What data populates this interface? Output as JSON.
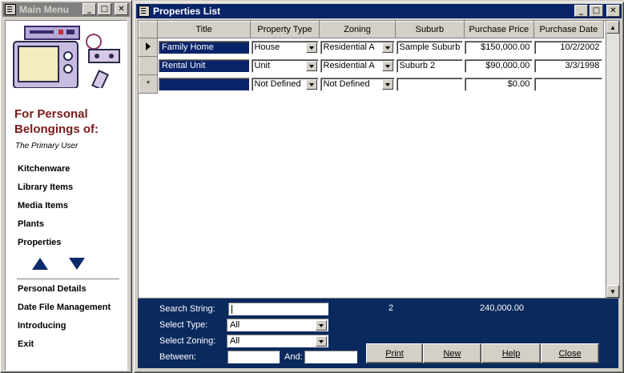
{
  "main_menu": {
    "title": "Main Menu",
    "tagline_1": "For Personal",
    "tagline_2": "Belongings of:",
    "user": "The Primary User",
    "categories": [
      "Kitchenware",
      "Library Items",
      "Media Items",
      "Plants",
      "Properties"
    ],
    "actions": [
      "Personal Details",
      "Date File Management",
      "Introducing",
      "Exit"
    ]
  },
  "props": {
    "title": "Properties List",
    "columns": [
      "Title",
      "Property Type",
      "Zoning",
      "Suburb",
      "Purchase Price",
      "Purchase Date"
    ],
    "rows": [
      {
        "selector": "current",
        "title": "Family Home",
        "type": "House",
        "zoning": "Residential A",
        "suburb": "Sample Suburb",
        "price": "$150,000.00",
        "date": "10/2/2002"
      },
      {
        "selector": "",
        "title": "Rental Unit",
        "type": "Unit",
        "zoning": "Residential A",
        "suburb": "Suburb 2",
        "price": "$90,000.00",
        "date": "3/3/1998"
      },
      {
        "selector": "*",
        "title": "",
        "type": "Not Defined",
        "zoning": "Not Defined",
        "suburb": "",
        "price": "$0.00",
        "date": ""
      }
    ],
    "footer": {
      "search_label": "Search String:",
      "search_value": "",
      "type_label": "Select  Type:",
      "type_value": "All",
      "zoning_label": "Select Zoning:",
      "zoning_value": "All",
      "between_label": "Between:",
      "and_label": "And:",
      "count": "2",
      "total": "240,000.00",
      "buttons": [
        "Print",
        "New",
        "Help",
        "Close"
      ]
    }
  },
  "colors": {
    "active_title": "#0a246a",
    "footer_bg": "#0a2a5e",
    "tagline": "#7b1a1a",
    "arrow": "#0a2a6a"
  },
  "icons": [
    "window-icon",
    "minimize-icon",
    "maximize-icon",
    "close-icon",
    "tv-illustration",
    "scroll-up-icon",
    "scroll-down-icon"
  ]
}
